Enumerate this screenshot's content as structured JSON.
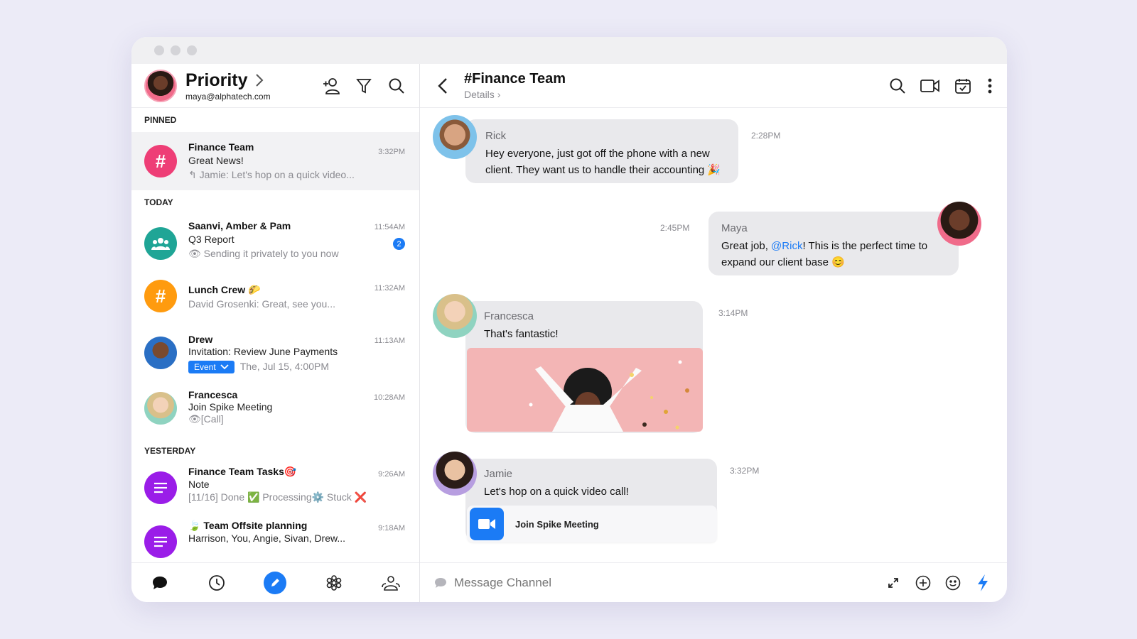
{
  "window": {
    "title_dots": [
      "close",
      "minimize",
      "maximize"
    ]
  },
  "account": {
    "name": "Priority",
    "email": "maya@alphatech.com"
  },
  "sections": {
    "pinned": "PINNED",
    "today": "TODAY",
    "yesterday": "YESTERDAY"
  },
  "conversations": [
    {
      "name": "Finance Team",
      "line": "Great News!",
      "sub": "Jamie: Let's hop on a quick video...",
      "time": "3:32PM",
      "avatar_icon": "hash-icon",
      "avatar_color": "#ee3e76"
    },
    {
      "name": "Saanvi, Amber & Pam",
      "line": "Q3 Report",
      "sub": "Sending it privately to you now",
      "time": "11:54AM",
      "badge": "2",
      "avatar_icon": "group-icon",
      "avatar_color": "#1fa596"
    },
    {
      "name": "Lunch Crew 🌮",
      "sub": "David Grosenki: Great, see you...",
      "time": "11:32AM",
      "avatar_icon": "hash-icon",
      "avatar_color": "#ff9b0f"
    },
    {
      "name": "Drew",
      "line": "Invitation: Review June Payments",
      "chip": "Event",
      "sub": "The, Jul 15, 4:00PM",
      "time": "11:13AM"
    },
    {
      "name": "Francesca",
      "line": "Join Spike Meeting",
      "sub": "[Call]",
      "time": "10:28AM"
    },
    {
      "name": "Finance Team Tasks🎯",
      "line": "Note",
      "sub": "[11/16] Done ✅ Processing⚙️ Stuck ❌",
      "time": "9:26AM",
      "avatar_icon": "note-icon",
      "avatar_color": "#9a1de8"
    },
    {
      "name": "🍃 Team Offsite planning",
      "line": "Harrison, You, Angie, Sivan, Drew...",
      "time": "9:18AM",
      "avatar_icon": "note-icon",
      "avatar_color": "#9a1de8"
    }
  ],
  "channel": {
    "title": "#Finance Team",
    "details": "Details"
  },
  "messages": [
    {
      "sender": "Rick",
      "text": "Hey everyone, just got off the phone with a new client. They want us to handle their accounting 🎉",
      "time": "2:28PM"
    },
    {
      "sender": "Maya",
      "text_before": "Great job, ",
      "mention": "@Rick",
      "text_after": "! This is the perfect time to expand our client base 😊",
      "time": "2:45PM"
    },
    {
      "sender": "Francesca",
      "text": "That's fantastic!",
      "time": "3:14PM"
    },
    {
      "sender": "Jamie",
      "text": "Let's hop on a quick video call!",
      "time": "3:32PM",
      "card_label": "Join Spike Meeting"
    }
  ],
  "composer": {
    "placeholder": "Message Channel"
  },
  "colors": {
    "accent": "#1b7bf5",
    "finance": "#ee3e76",
    "group": "#1fa596",
    "lunch": "#ff9b0f",
    "tasks": "#9a1de8"
  }
}
